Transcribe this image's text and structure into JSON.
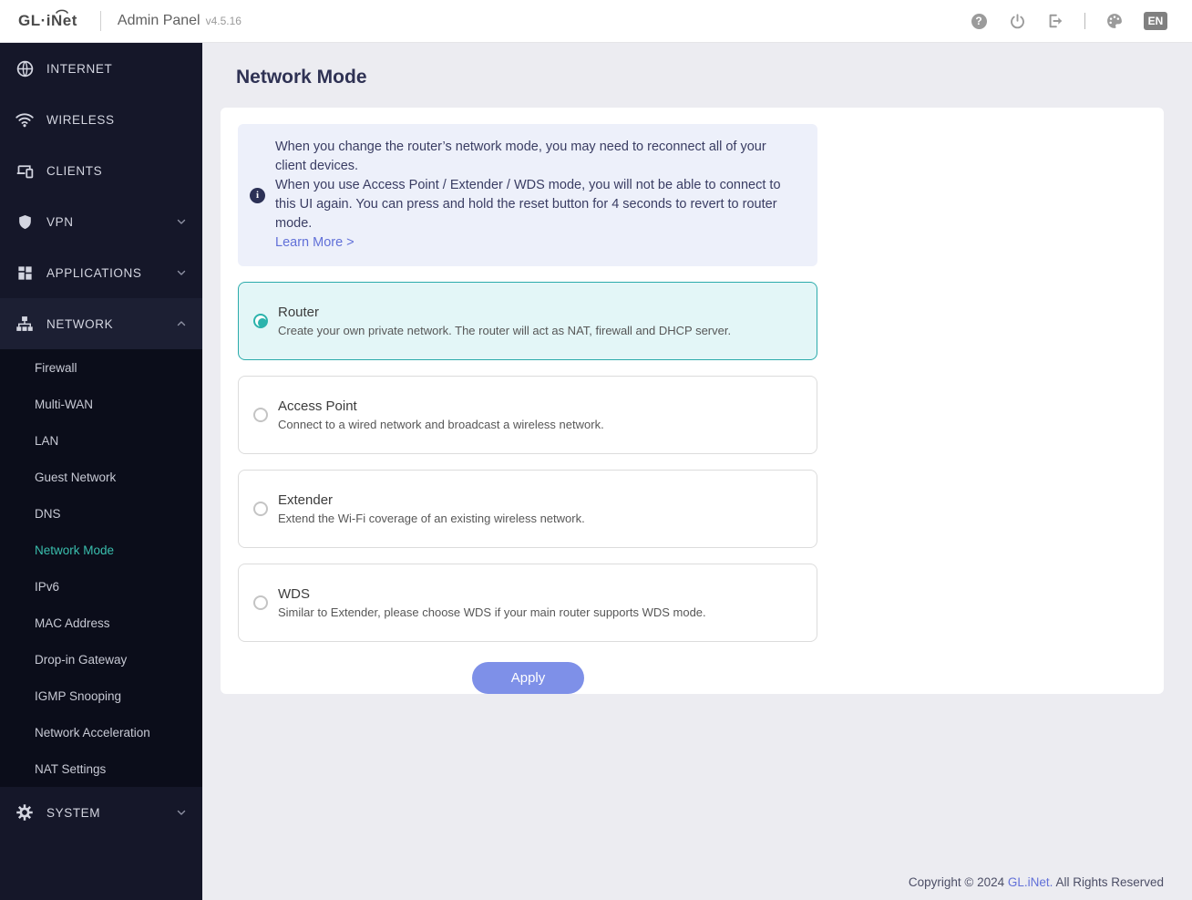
{
  "header": {
    "logo_text": "GL·iNet",
    "app_title": "Admin Panel",
    "version": "v4.5.16",
    "help_glyph": "?",
    "language": "EN"
  },
  "sidebar": {
    "items": [
      {
        "label": "INTERNET",
        "icon": "globe-icon"
      },
      {
        "label": "WIRELESS",
        "icon": "wifi-icon"
      },
      {
        "label": "CLIENTS",
        "icon": "devices-icon"
      },
      {
        "label": "VPN",
        "icon": "shield-icon",
        "chevron": "down"
      },
      {
        "label": "APPLICATIONS",
        "icon": "grid-icon",
        "chevron": "down"
      },
      {
        "label": "NETWORK",
        "icon": "sitemap-icon",
        "chevron": "up",
        "expanded": true
      }
    ],
    "network_submenu": {
      "items": [
        {
          "label": "Firewall"
        },
        {
          "label": "Multi-WAN"
        },
        {
          "label": "LAN"
        },
        {
          "label": "Guest Network"
        },
        {
          "label": "DNS"
        },
        {
          "label": "Network Mode",
          "active": true
        },
        {
          "label": "IPv6"
        },
        {
          "label": "MAC Address"
        },
        {
          "label": "Drop-in Gateway"
        },
        {
          "label": "IGMP Snooping"
        },
        {
          "label": "Network Acceleration"
        },
        {
          "label": "NAT Settings"
        }
      ]
    },
    "system_item": {
      "label": "SYSTEM",
      "icon": "gear-icon",
      "chevron": "down"
    }
  },
  "main": {
    "page_title": "Network Mode",
    "info": {
      "line1": "When you change the router’s network mode, you may need to reconnect all of your client devices.",
      "line2": "When you use Access Point / Extender / WDS mode, you will not be able to connect to this UI again. You can press and hold the reset button for 4 seconds to revert to router mode.",
      "link": "Learn More >"
    },
    "options": [
      {
        "title": "Router",
        "description": "Create your own private network. The router will act as NAT, firewall and DHCP server.",
        "selected": true
      },
      {
        "title": "Access Point",
        "description": "Connect to a wired network and broadcast a wireless network.",
        "selected": false
      },
      {
        "title": "Extender",
        "description": "Extend the Wi-Fi coverage of an existing wireless network.",
        "selected": false
      },
      {
        "title": "WDS",
        "description": "Similar to Extender, please choose WDS if your main router supports WDS mode.",
        "selected": false
      }
    ],
    "apply_label": "Apply"
  },
  "footer": {
    "prefix": "Copyright © 2024 ",
    "link": "GL.iNet.",
    "suffix": " All Rights Reserved"
  },
  "colors": {
    "accent_teal": "#2bb3ac",
    "accent_indigo": "#7e90e8",
    "link_blue": "#6170d8",
    "sidebar_bg": "#151729",
    "submenu_bg": "#0b0d1a",
    "selected_card_bg": "#e3f6f7",
    "info_bg": "#edf0fa"
  }
}
